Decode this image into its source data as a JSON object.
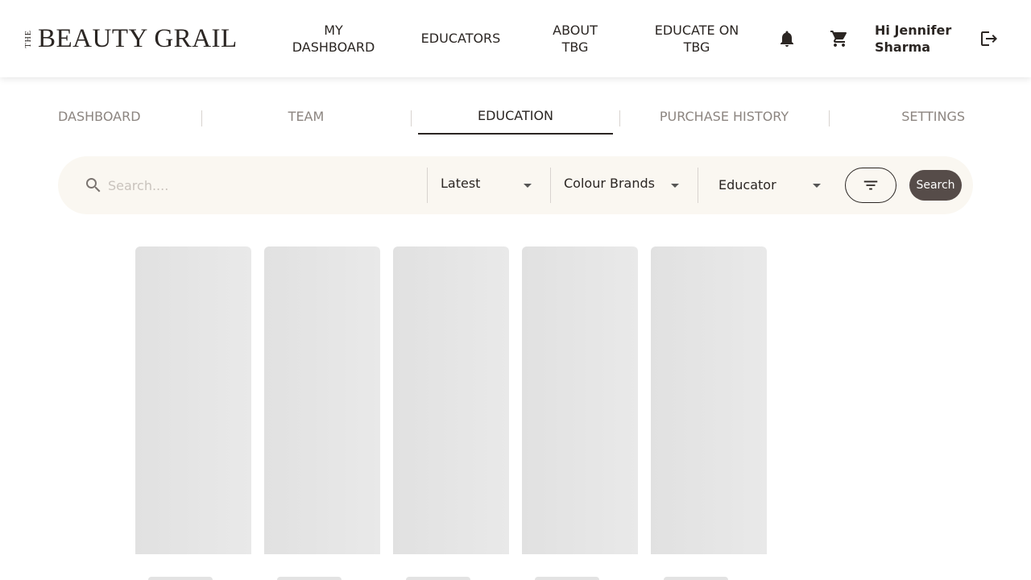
{
  "header": {
    "logo_prefix": "THE",
    "logo_text": "BEAUTY GRAIL",
    "nav": {
      "my_dashboard": "MY DASHBOARD",
      "educators": "EDUCATORS",
      "about": "ABOUT TBG",
      "educate_on": "EDUCATE ON TBG"
    },
    "greeting": "Hi Jennifer Sharma",
    "icons": [
      "bell-icon",
      "cart-icon",
      "logout-icon"
    ]
  },
  "tabs": {
    "dashboard": "DASHBOARD",
    "team": "TEAM",
    "education": "EDUCATION",
    "purchase_history": "PURCHASE HISTORY",
    "settings": "SETTINGS",
    "active": "EDUCATION"
  },
  "search": {
    "placeholder": "Search....",
    "value": "",
    "sort": "Latest",
    "brands": "Colour Brands",
    "educator": "Educator",
    "button": "Search"
  },
  "colors": {
    "text": "#2b2623",
    "muted": "#8c8580",
    "search_bg": "#faf7f1",
    "button_bg": "#564c49",
    "skeleton": "#e3e3e3"
  },
  "content": {
    "loading_cards": 5
  }
}
